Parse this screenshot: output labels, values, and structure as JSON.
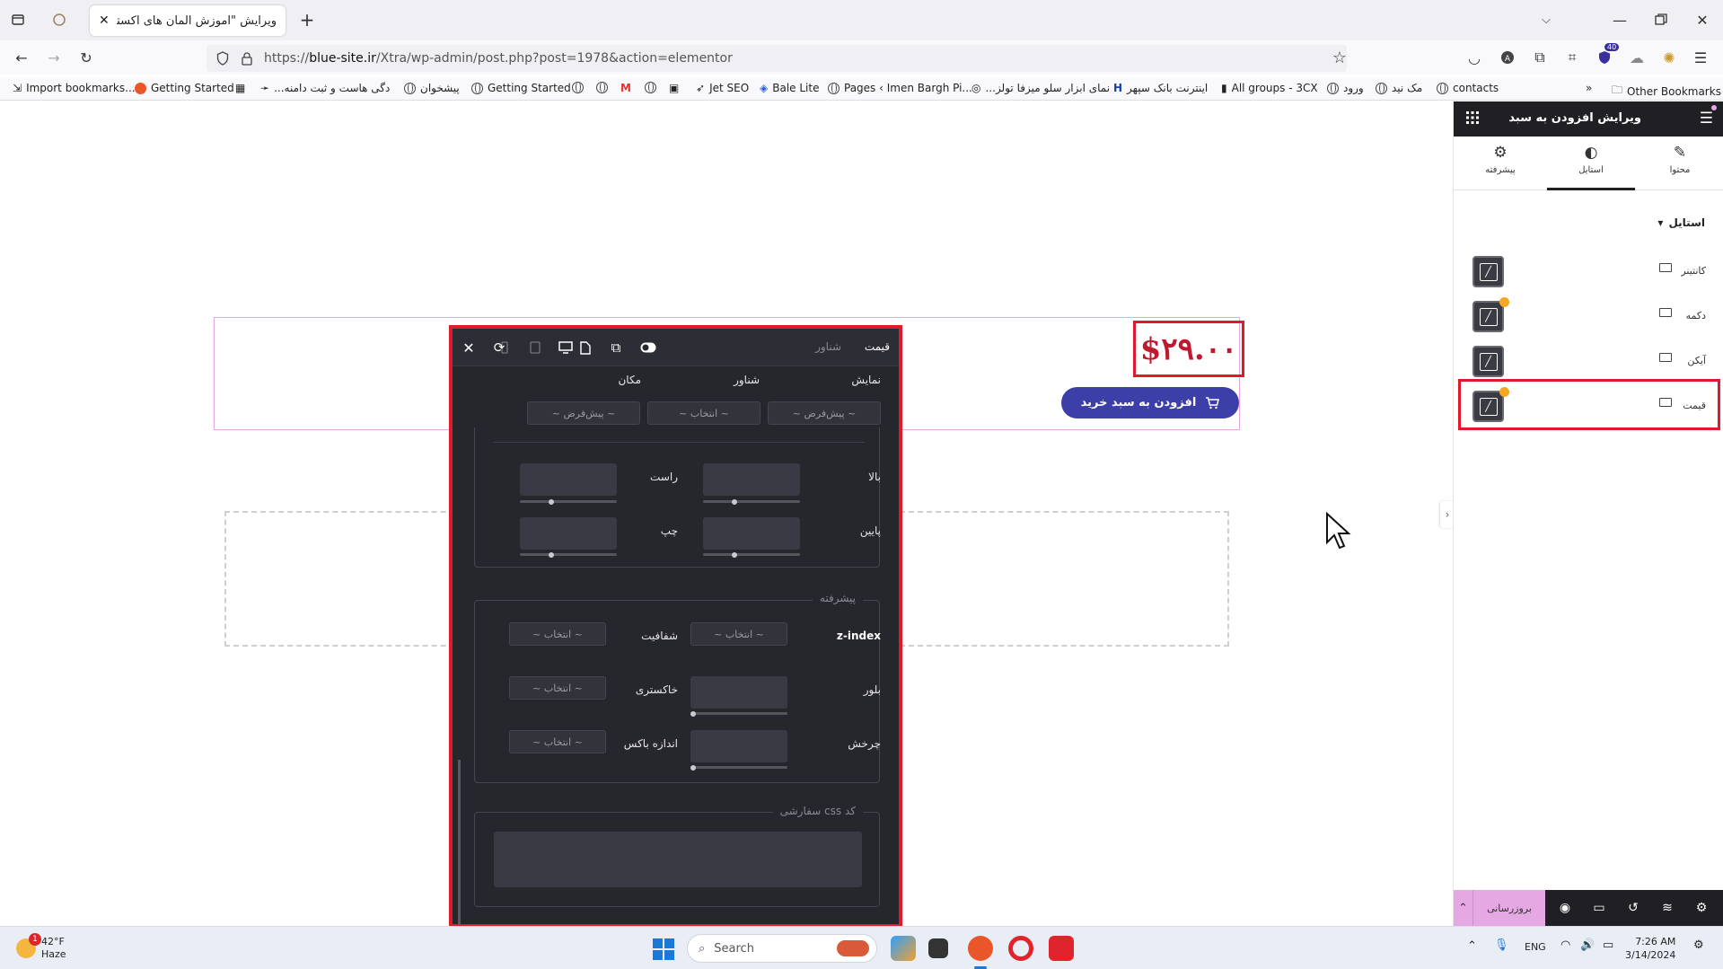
{
  "browser": {
    "tab_title": "ویرایش \"آموزش المان های اکسترا – ...",
    "url_prefix": "https://",
    "url_domain": "blue-site.ir",
    "url_path": "/Xtra/wp-admin/post.php?post=1978&action=elementor",
    "extension_badge": "40",
    "bookmarks": [
      "Import bookmarks...",
      "Getting Started",
      "...دگی هاست و ثبت دامنه",
      "پیشخوان",
      "Getting Started",
      "Jet SEO",
      "Bale Lite",
      "Pages ‹ Imen Bargh Pi...",
      "...نمای ابزار سلو میزفا تولز",
      "اینترنت بانک سپهر",
      "All groups - 3CX",
      "ورود",
      "مک نید",
      "contacts"
    ],
    "other_bookmarks": "Other Bookmarks"
  },
  "canvas": {
    "price": "$۲۹.۰۰",
    "cart_button": "افزودن به سبد خرید"
  },
  "panel": {
    "tab_price": "قیمت",
    "tab_floating": "شناور",
    "pos_labels": {
      "display": "نمایش",
      "floating": "شناور",
      "position": "مکان"
    },
    "pos_values": {
      "display": "~ پیش‌فرض ~",
      "floating": "~ انتخاب ~",
      "position": "~ پیش‌فرض ~"
    },
    "margin_labels": {
      "top": "بالا",
      "right": "راست",
      "bottom": "پایین",
      "left": "چپ"
    },
    "advanced_title": "پیشرفته",
    "zindex": "z-index",
    "opacity": "شفافیت",
    "blur": "بلور",
    "grayscale": "خاکستری",
    "rotate": "چرخش",
    "box_size": "اندازه باکس",
    "select_placeholder": "~ انتخاب ~",
    "css_title": "کد css سفارشی"
  },
  "sidebar": {
    "title": "ویرایش افزودن به سبد",
    "tabs": {
      "content": "محتوا",
      "style": "استایل",
      "advanced": "پیشرفته"
    },
    "section": "استایل",
    "rows": [
      {
        "label": "کانتینر",
        "dot": false
      },
      {
        "label": "دکمه",
        "dot": true
      },
      {
        "label": "آیکن",
        "dot": false
      },
      {
        "label": "قیمت",
        "dot": true
      }
    ],
    "update": "بروزرسانی"
  },
  "taskbar": {
    "temperature": "42°F",
    "condition": "Haze",
    "weather_badge": "1",
    "search": "Search",
    "lang": "ENG",
    "time": "7:26 AM",
    "date": "3/14/2024"
  },
  "colors": {
    "highlight_red": "#e01a2a",
    "price_red": "#c0182f",
    "button_blue": "#3d3fa8",
    "panel_bg": "#26262d",
    "update_pink": "#e6a8e3",
    "badge_orange": "#f5a623"
  }
}
